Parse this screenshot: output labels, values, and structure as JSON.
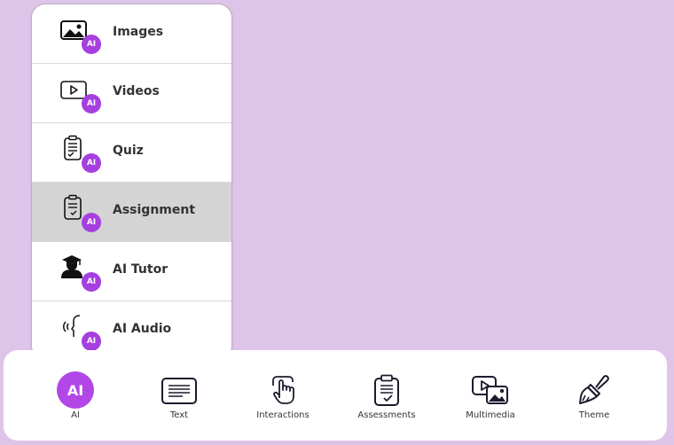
{
  "menu": {
    "items": [
      {
        "label": "Images",
        "icon": "image-icon",
        "badge": "AI"
      },
      {
        "label": "Videos",
        "icon": "video-icon",
        "badge": "AI"
      },
      {
        "label": "Quiz",
        "icon": "quiz-icon",
        "badge": "AI"
      },
      {
        "label": "Assignment",
        "icon": "assignment-icon",
        "badge": "AI",
        "active": true
      },
      {
        "label": "AI Tutor",
        "icon": "tutor-icon",
        "badge": "AI"
      },
      {
        "label": "AI Audio",
        "icon": "audio-icon",
        "badge": "AI"
      }
    ]
  },
  "toolbar": {
    "ai": {
      "label": "AI",
      "icon_text": "AI"
    },
    "text": {
      "label": "Text",
      "icon": "text-icon"
    },
    "interactions": {
      "label": "Interactions",
      "icon": "pointer-hand-icon"
    },
    "assessments": {
      "label": "Assessments",
      "icon": "clipboard-check-icon"
    },
    "multimedia": {
      "label": "Multimedia",
      "icon": "multimedia-icon"
    },
    "theme": {
      "label": "Theme",
      "icon": "paintbrush-icon"
    }
  },
  "colors": {
    "background": "#dfc4ea",
    "accent": "#b247e8",
    "badge": "#a63fe0",
    "active_row": "#d4d4d4"
  }
}
